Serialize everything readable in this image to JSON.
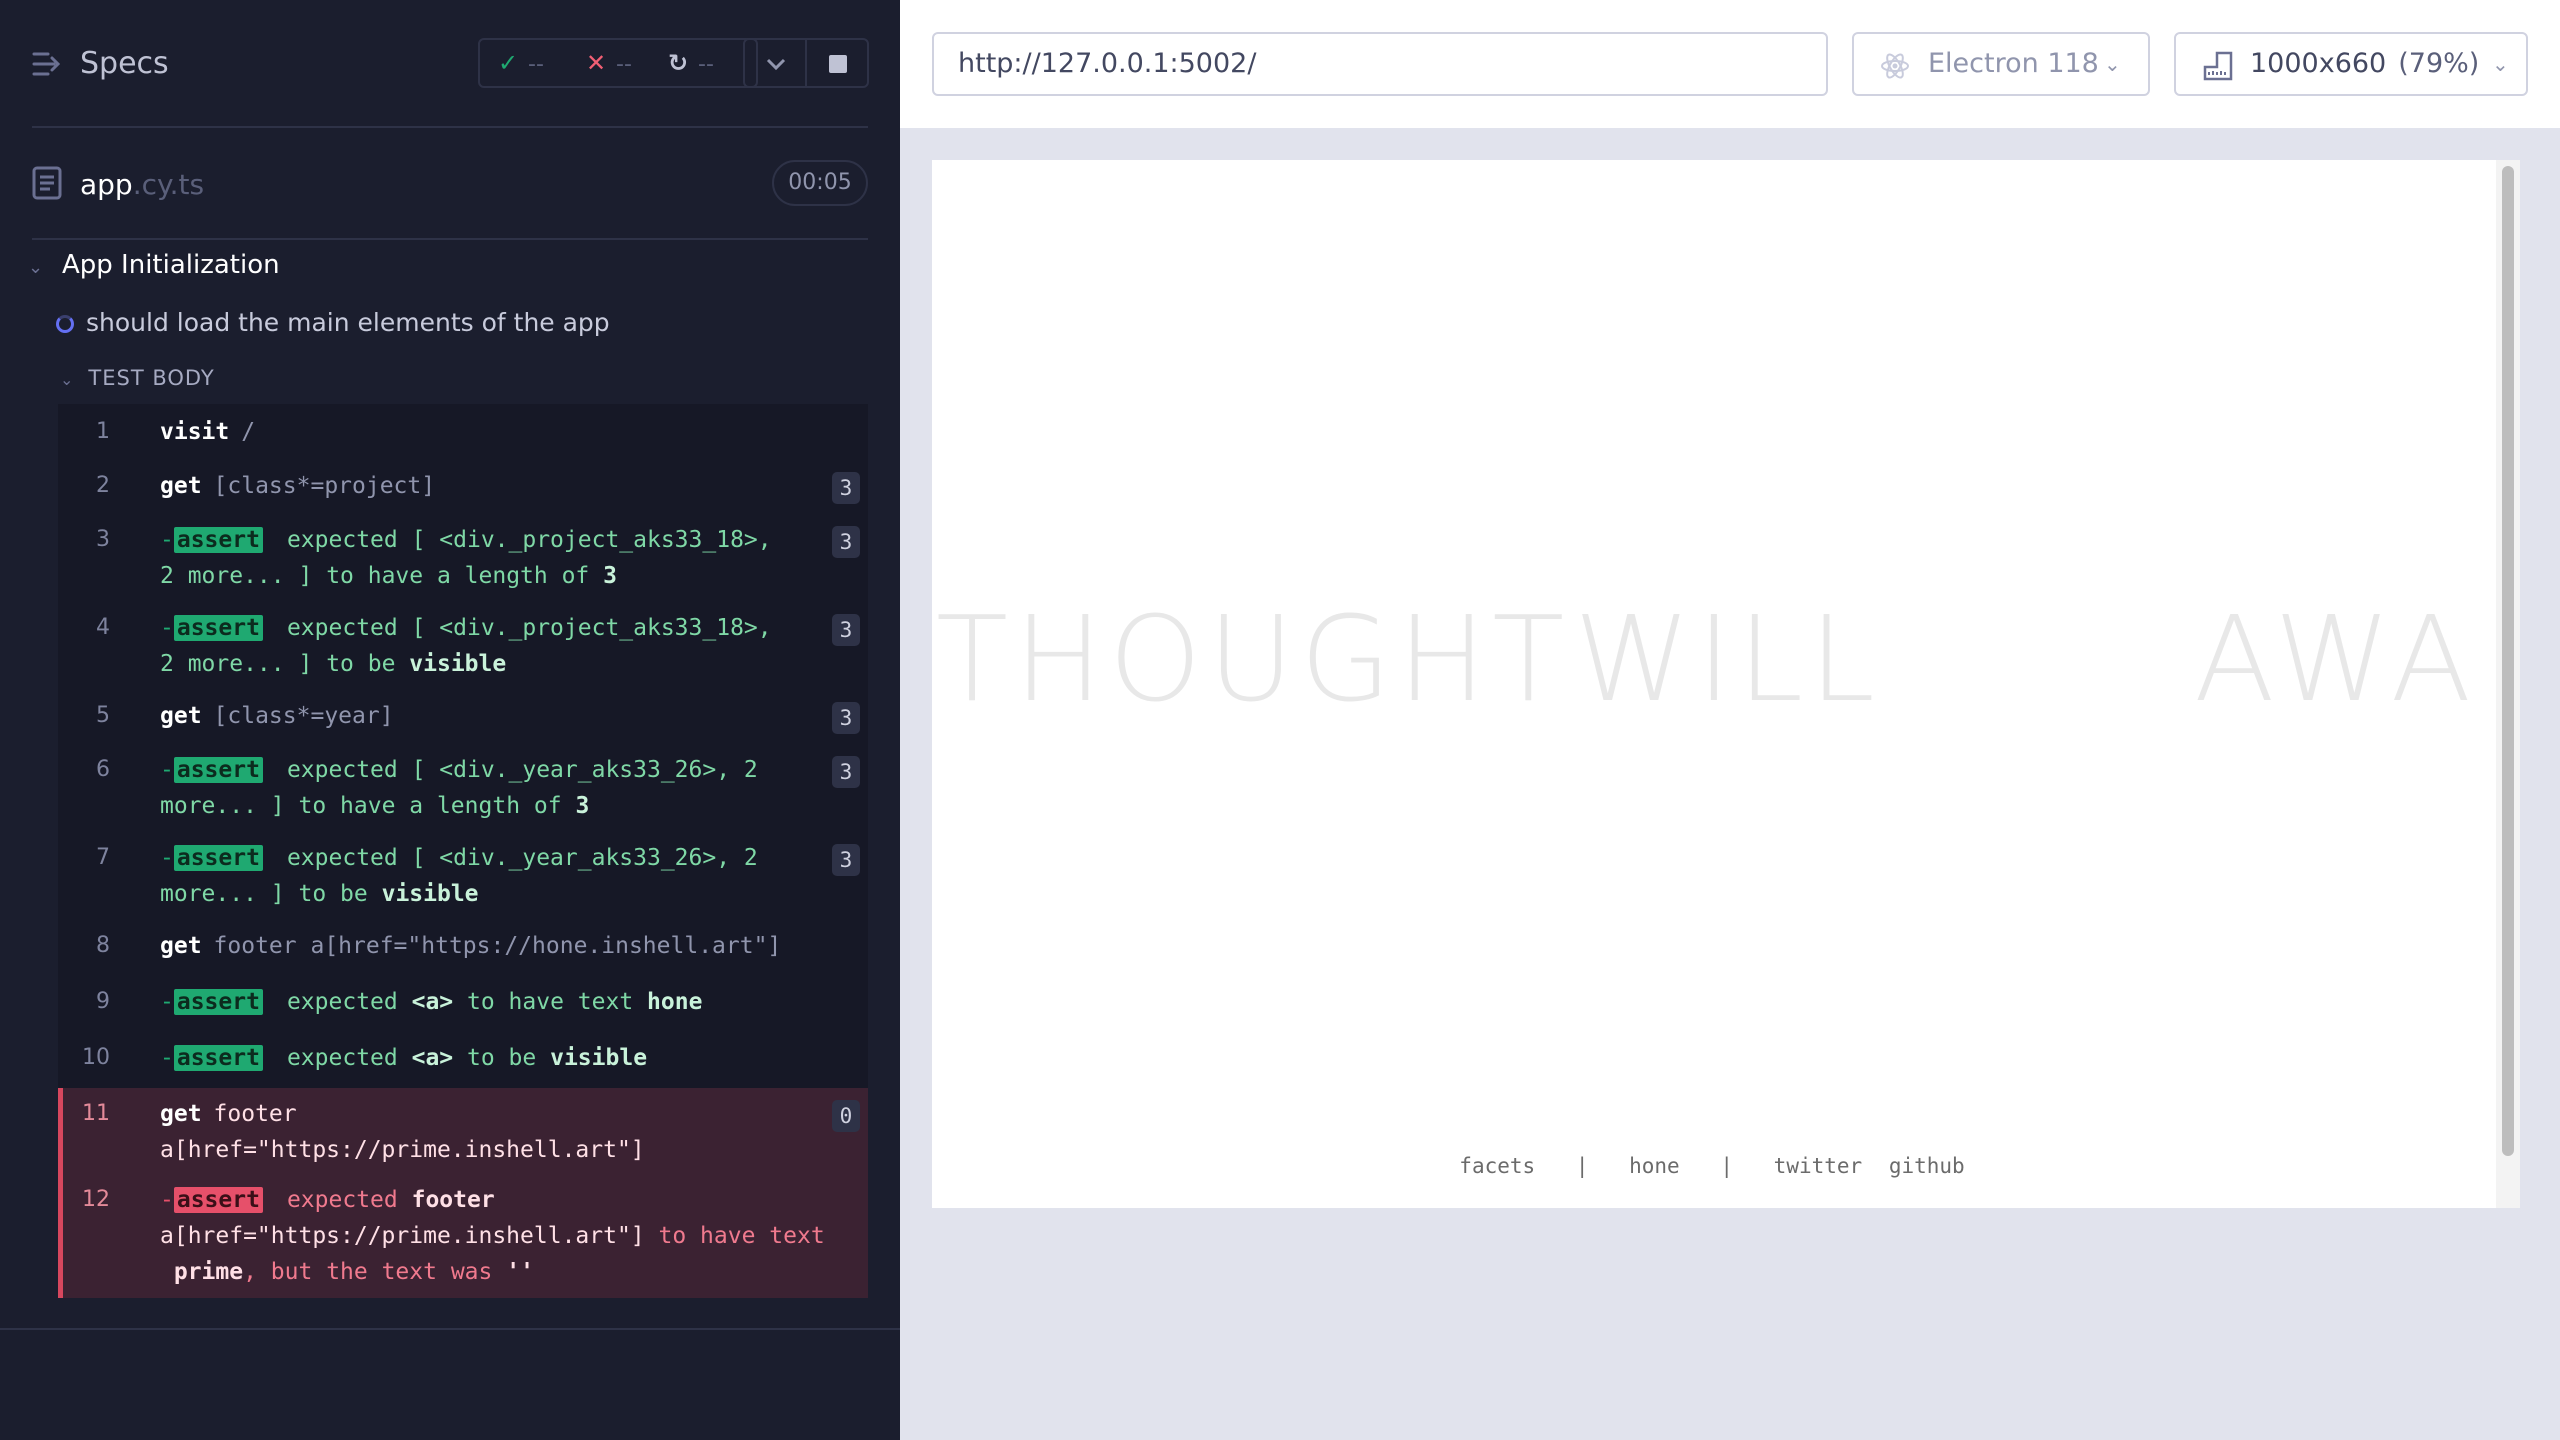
{
  "reporter": {
    "title": "Specs",
    "stats": {
      "passed": "--",
      "failed": "--",
      "pending": "--"
    },
    "file": {
      "name": "app",
      "ext": ".cy.ts",
      "duration": "00:05"
    },
    "suite": "App Initialization",
    "test": "should load the main elements of the app",
    "test_body_label": "TEST BODY",
    "commands": [
      {
        "n": "1",
        "cmd": "visit",
        "arg": "/"
      },
      {
        "n": "2",
        "cmd": "get",
        "arg": "[class*=project]",
        "badge": "3"
      },
      {
        "n": "3",
        "label": "assert",
        "line1": "expected [ <div._project_aks33_18>,",
        "line2a": "2 more... ]",
        "line2b": "to have a length of",
        "line2c": "3",
        "badge": "3"
      },
      {
        "n": "4",
        "label": "assert",
        "line1": "expected [ <div._project_aks33_18>,",
        "line2a": "2 more... ]",
        "line2b": "to be",
        "line2c": "visible",
        "badge": "3"
      },
      {
        "n": "5",
        "cmd": "get",
        "arg": "[class*=year]",
        "badge": "3"
      },
      {
        "n": "6",
        "label": "assert",
        "line1": "expected [ <div._year_aks33_26>, 2",
        "line2a": "more... ]",
        "line2b": "to have a length of",
        "line2c": "3",
        "badge": "3"
      },
      {
        "n": "7",
        "label": "assert",
        "line1": "expected [ <div._year_aks33_26>, 2",
        "line2a": "more... ]",
        "line2b": "to be",
        "line2c": "visible",
        "badge": "3"
      },
      {
        "n": "8",
        "cmd": "get",
        "arg": "footer a[href=\"https://hone.inshell.art\"]"
      },
      {
        "n": "9",
        "label": "assert",
        "a1": "expected",
        "a2": "<a>",
        "a3": "to have text",
        "a4": "hone"
      },
      {
        "n": "10",
        "label": "assert",
        "a1": "expected",
        "a2": "<a>",
        "a3": "to be",
        "a4": "visible"
      },
      {
        "n": "11",
        "cmd": "get",
        "arg1": "footer",
        "arg2": "a[href=\"https://prime.inshell.art\"]",
        "badge": "0"
      },
      {
        "n": "12",
        "label": "assert",
        "l1a": "expected",
        "l1b": "footer",
        "l2a": "a[href=\"https://prime.inshell.art\"]",
        "l2b": "to have text",
        "l3a": "prime",
        "l3b": ", but the text was",
        "l3c": "''"
      }
    ]
  },
  "aut": {
    "url": "http://127.0.0.1:5002/",
    "browser": "Electron 118",
    "viewport": "1000x660",
    "zoom": "(79%)",
    "hero": [
      "THOUGHT",
      "WILL",
      "AWA!"
    ],
    "footer_links": [
      "facets",
      "|",
      "hone",
      "|",
      "twitter",
      "github"
    ]
  },
  "colors": {
    "pass": "#1fa971",
    "fail": "#f15f74",
    "accent": "#6470f3",
    "panel": "#1b1e2e"
  }
}
